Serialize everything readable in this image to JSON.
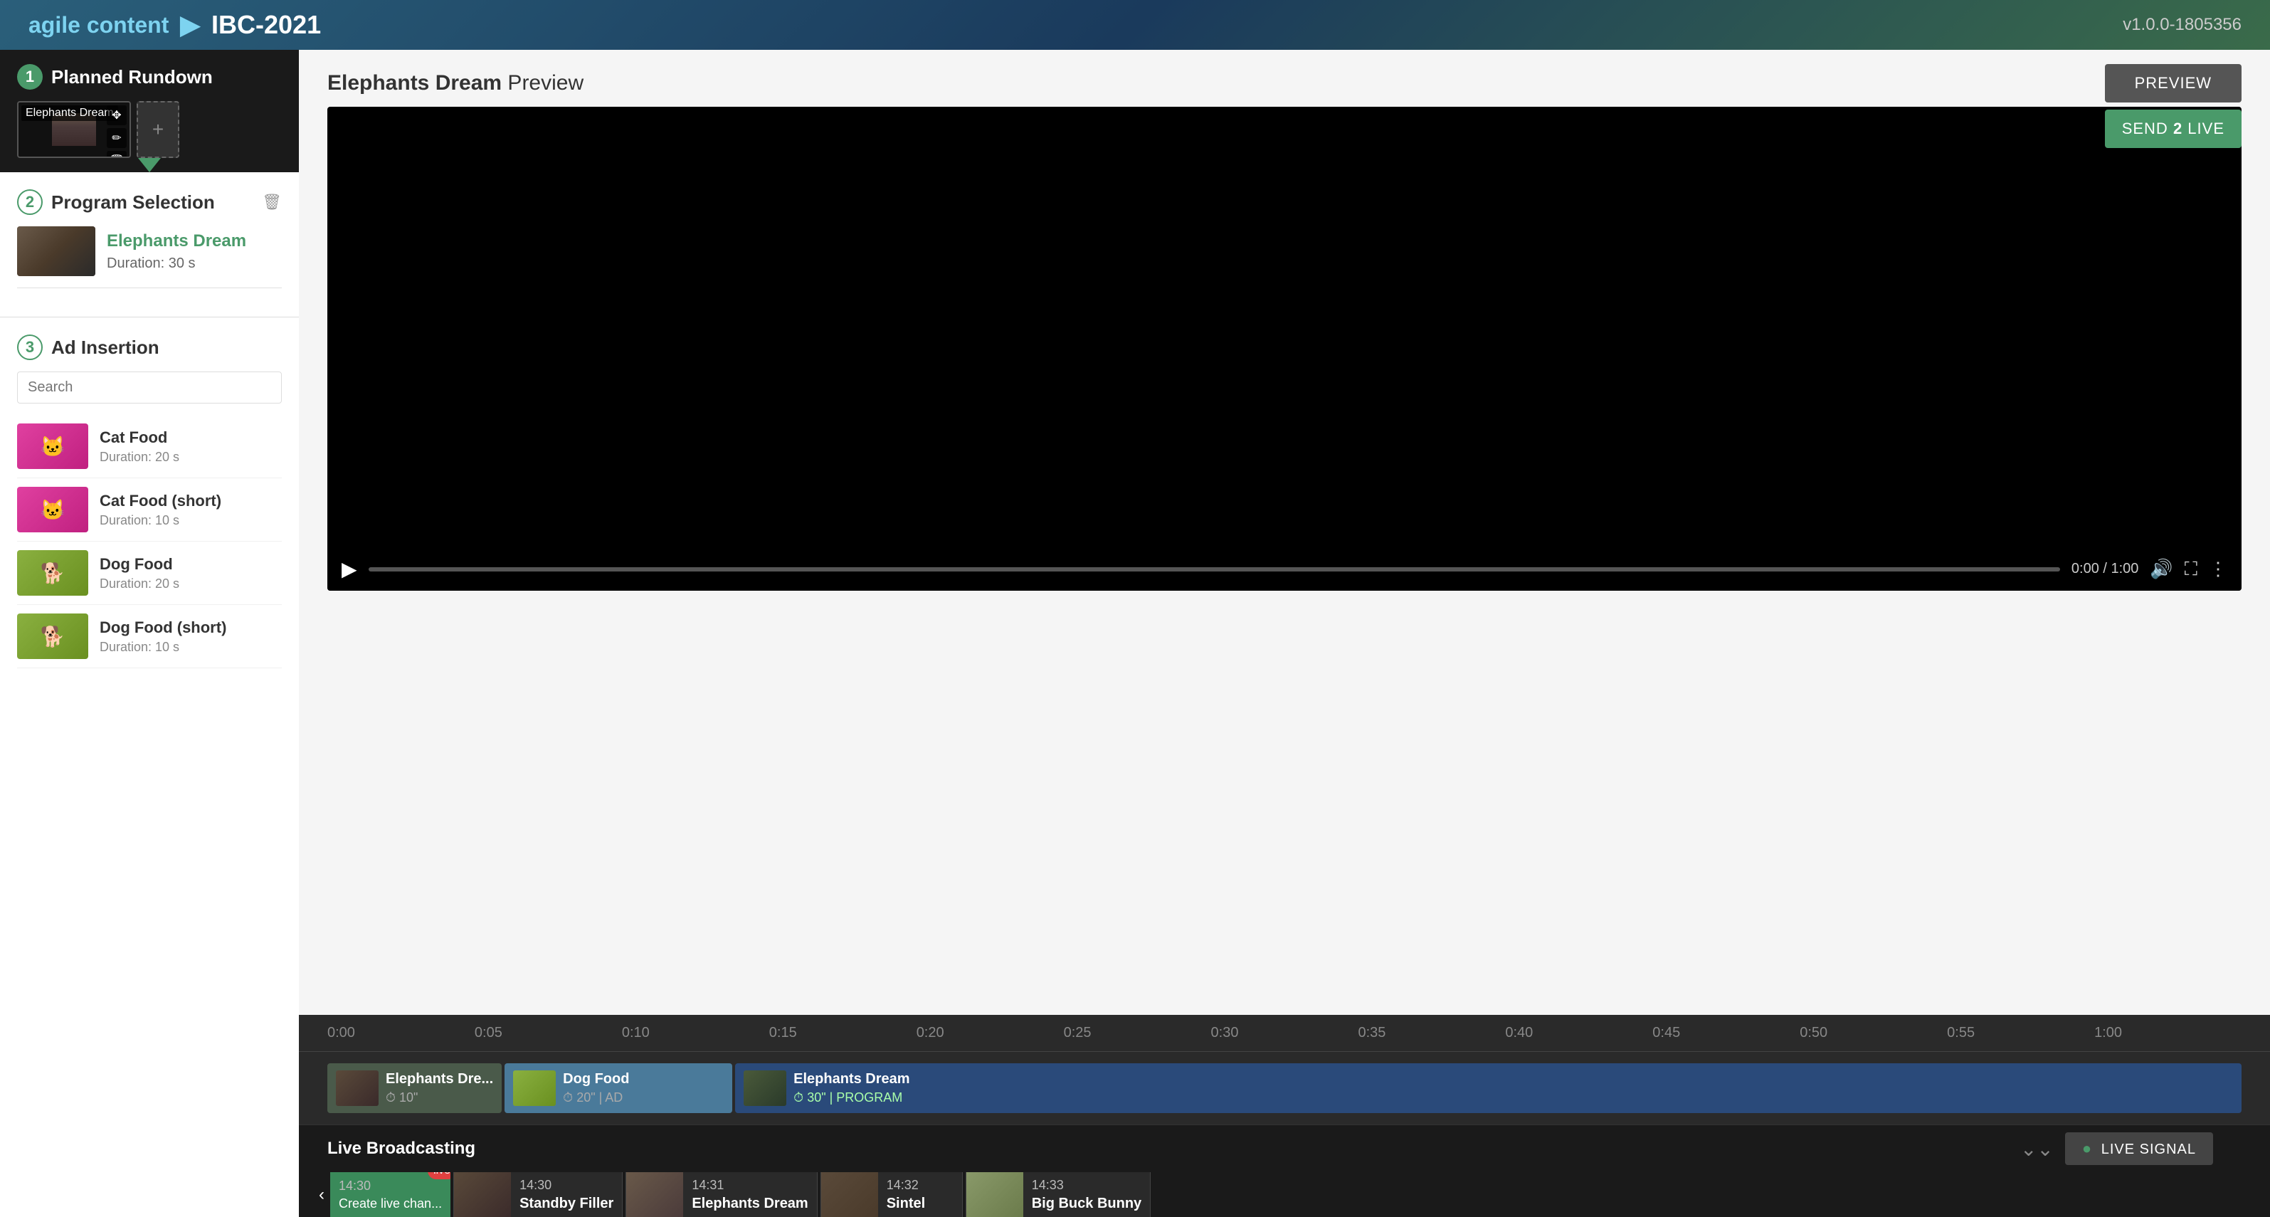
{
  "app": {
    "brand": "agile content",
    "arrow": "▶",
    "event": "IBC-2021",
    "version": "v1.0.0-1805356"
  },
  "planned_rundown": {
    "section_number": "1",
    "section_title": "Planned Rundown",
    "rundown_item_label": "Elephants Dream",
    "add_label": "+"
  },
  "program_selection": {
    "section_number": "2",
    "section_title": "Program Selection",
    "program_title": "Elephants Dream",
    "program_duration": "Duration: 30 s"
  },
  "ad_insertion": {
    "section_number": "3",
    "section_title": "Ad Insertion",
    "search_placeholder": "Search",
    "ads": [
      {
        "title": "Cat Food",
        "duration": "Duration: 20 s",
        "type": "cat"
      },
      {
        "title": "Cat Food (short)",
        "duration": "Duration: 10 s",
        "type": "cat"
      },
      {
        "title": "Dog Food",
        "duration": "Duration: 20 s",
        "type": "dog"
      },
      {
        "title": "Dog Food (short)",
        "duration": "Duration: 10 s",
        "type": "dog"
      }
    ]
  },
  "preview": {
    "title_bold": "Elephants Dream",
    "title_normal": " Preview",
    "time": "0:00 / 1:00"
  },
  "timeline": {
    "marks": [
      "0:00",
      "0:05",
      "0:10",
      "0:15",
      "0:20",
      "0:25",
      "0:30",
      "0:35",
      "0:40",
      "0:45",
      "0:50",
      "0:55",
      "1:00"
    ],
    "track1_title": "Elephants Dre...",
    "track1_meta": "⏱ 10\"",
    "track2_title": "Dog Food",
    "track2_meta": "⏱ 20\" | AD",
    "track3_title": "Elephants Dream",
    "track3_meta": "⏱ 30\" | PROGRAM"
  },
  "buttons": {
    "preview": "PREVIEW",
    "send_live": "SEND 2 LIVE"
  },
  "live_broadcasting": {
    "title": "Live Broadcasting",
    "live_signal": "LIVE SIGNAL",
    "items": [
      {
        "time": "14:30",
        "label": "Standby Filler",
        "type": "green",
        "has_live": false
      },
      {
        "time": "14:30",
        "label": "Create live chan...",
        "type": "create",
        "has_live": true
      },
      {
        "time": "14:31",
        "label": "Elephants Dream",
        "type": "dark",
        "has_live": false
      },
      {
        "time": "14:32",
        "label": "Sintel",
        "type": "dark",
        "has_live": false
      },
      {
        "time": "14:33",
        "label": "Big Buck Bunny",
        "type": "dark",
        "has_live": false
      }
    ]
  },
  "bottom_left": {
    "time": "14:30",
    "label": "Create chan Standby Filler"
  }
}
